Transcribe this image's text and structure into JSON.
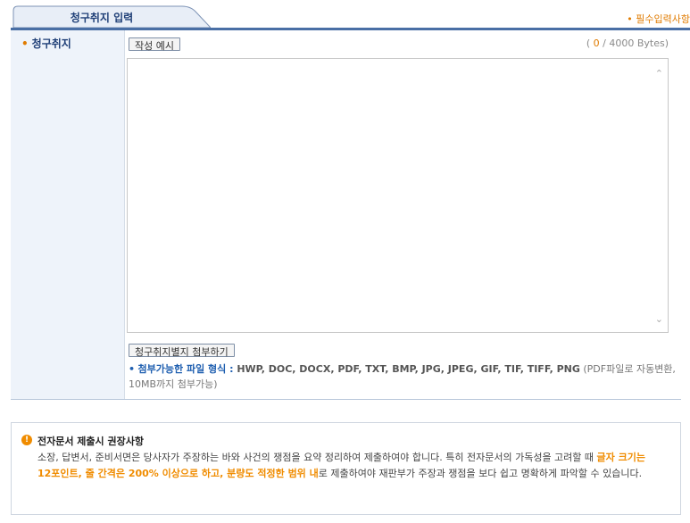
{
  "tab": {
    "label": "청구취지 입력",
    "required_note": "• 필수입력사항"
  },
  "form": {
    "field_label": "청구취지",
    "example_button": "작성 예시",
    "byte_count": {
      "open": "( ",
      "current": "0",
      "sep": " / 4000 Bytes)"
    },
    "textarea_value": "",
    "attach_button": "청구취지별지 첨부하기",
    "file_info": {
      "bullet": "•",
      "label": "첨부가능한 파일 형식 : ",
      "formats": "HWP, DOC, DOCX, PDF, TXT, BMP, JPG, JPEG, GIF, TIF, TIFF, PNG",
      "note": " (PDF파일로 자동변환, 10MB까지 첨부가능)"
    }
  },
  "notice": {
    "icon": "!",
    "title": "전자문서 제출시 권장사항",
    "body_1": "소장, 답변서, 준비서면은 당사자가 주장하는 바와 사건의 쟁점을 요약 정리하여 제출하여야 합니다. 특히 전자문서의 가독성을 고려할 때 ",
    "highlight": "글자 크기는 12포인트, 줄 간격은 200% 이상으로 하고, 분량도 적정한 범위 내",
    "body_2": "로 제출하여야 재판부가 주장과 쟁점을 보다 쉽고 명확하게 파악할 수 있습니다."
  },
  "colors": {
    "accent": "#1f3f77",
    "orange": "#e07b00",
    "line": "#4a6fa5"
  },
  "icons": {
    "scroll_up": "chevron-up-icon",
    "scroll_down": "chevron-down-icon",
    "notice": "alert-icon"
  }
}
